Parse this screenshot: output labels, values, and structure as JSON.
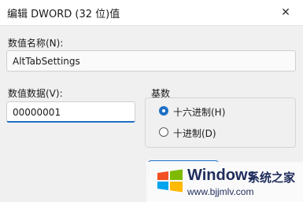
{
  "window": {
    "title": "编辑 DWORD (32 位)值",
    "close_glyph": "✕"
  },
  "value_name": {
    "label": "数值名称(N):",
    "value": "AltTabSettings"
  },
  "value_data": {
    "label": "数值数据(V):",
    "value": "00000001"
  },
  "base": {
    "title": "基数",
    "options": [
      {
        "label": "十六进制(H)",
        "selected": true
      },
      {
        "label": "十进制(D)",
        "selected": false
      }
    ]
  },
  "watermark": {
    "brand": "Windows",
    "cn": "系统之家",
    "url": "www.bjjmlv.com"
  },
  "colors": {
    "accent": "#1f6fc5",
    "background": "#f0f0f0"
  }
}
